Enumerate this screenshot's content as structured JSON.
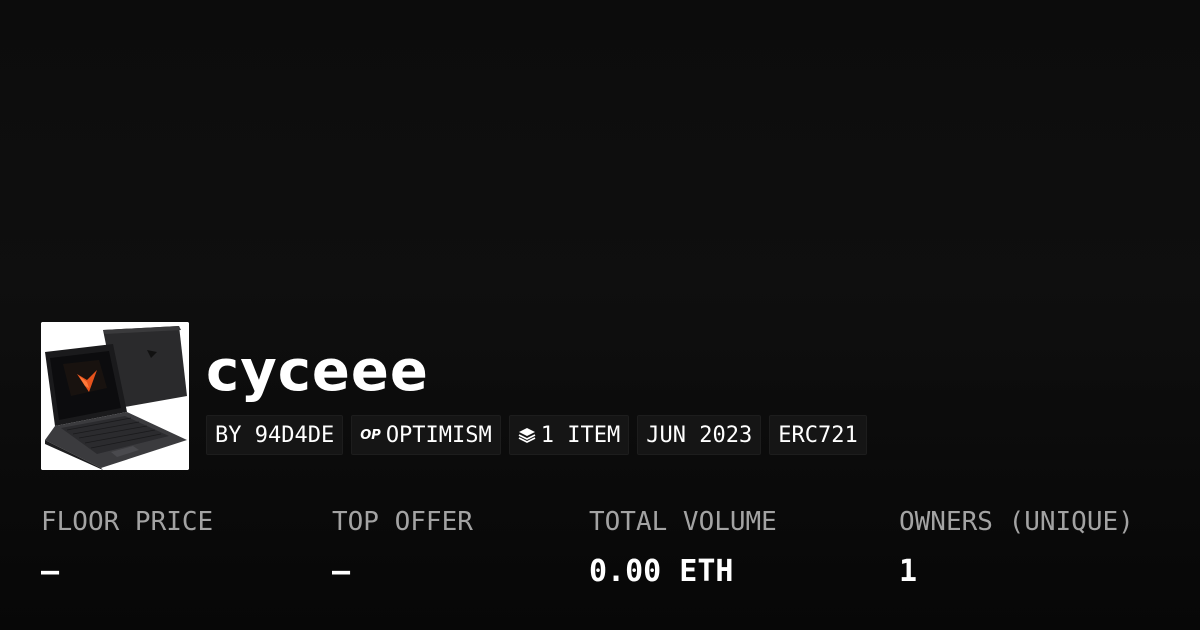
{
  "collection": {
    "name": "cyceee",
    "thumbnail_icon": "laptop-image"
  },
  "badges": {
    "creator": "BY 94D4DE",
    "chain_icon_text": "OP",
    "chain": "OPTIMISM",
    "items": "1 ITEM",
    "created": "JUN 2023",
    "standard": "ERC721"
  },
  "stats": {
    "floor_price": {
      "label": "FLOOR PRICE",
      "value": "–"
    },
    "top_offer": {
      "label": "TOP OFFER",
      "value": "–"
    },
    "total_volume": {
      "label": "TOTAL VOLUME",
      "value": "0.00 ETH"
    },
    "owners": {
      "label": "OWNERS (UNIQUE)",
      "value": "1"
    }
  }
}
